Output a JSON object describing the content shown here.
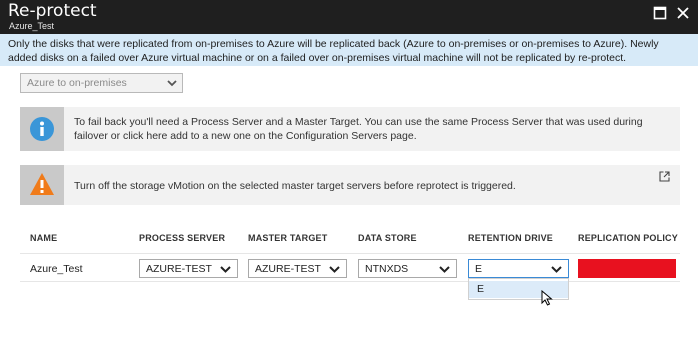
{
  "window": {
    "title": "Re-protect",
    "subtitle": "Azure_Test",
    "maximize_icon": "maximize-icon",
    "close_icon": "close-icon"
  },
  "info_banner": {
    "text": "Only the disks that were replicated from on-premises to Azure will be replicated back (Azure to on-premises or on-premises to Azure). Newly added disks on a failed over Azure virtual machine or on a failed over on-premises virtual machine will not be replicated by re-protect."
  },
  "direction": {
    "value": "Azure to on-premises"
  },
  "notices": {
    "process_server": {
      "icon": "info-icon",
      "text": "To fail back you'll need a Process Server and a Master Target. You can use the same Process Server that was used during failover or click here add to a new one on the Configuration Servers page."
    },
    "vmotion": {
      "icon": "warning-icon",
      "text": "Turn off the storage vMotion on the selected master target servers before reprotect is triggered."
    }
  },
  "table": {
    "headers": {
      "name": "NAME",
      "process_server": "PROCESS SERVER",
      "master_target": "MASTER TARGET",
      "data_store": "DATA STORE",
      "retention_drive": "RETENTION DRIVE",
      "replication_policy": "REPLICATION POLICY"
    },
    "row": {
      "name": "Azure_Test",
      "process_server": "AZURE-TEST",
      "master_target": "AZURE-TEST",
      "data_store": "NTNXDS",
      "retention_drive": "E"
    },
    "retention_options": [
      "E"
    ]
  },
  "colors": {
    "titlebar": "#1f1f1f",
    "banner": "#d7eaf8",
    "policy_error": "#e8111f",
    "info_icon": "#3a96d8",
    "warning_icon": "#f07b1a",
    "focus": "#3a8ad6"
  }
}
